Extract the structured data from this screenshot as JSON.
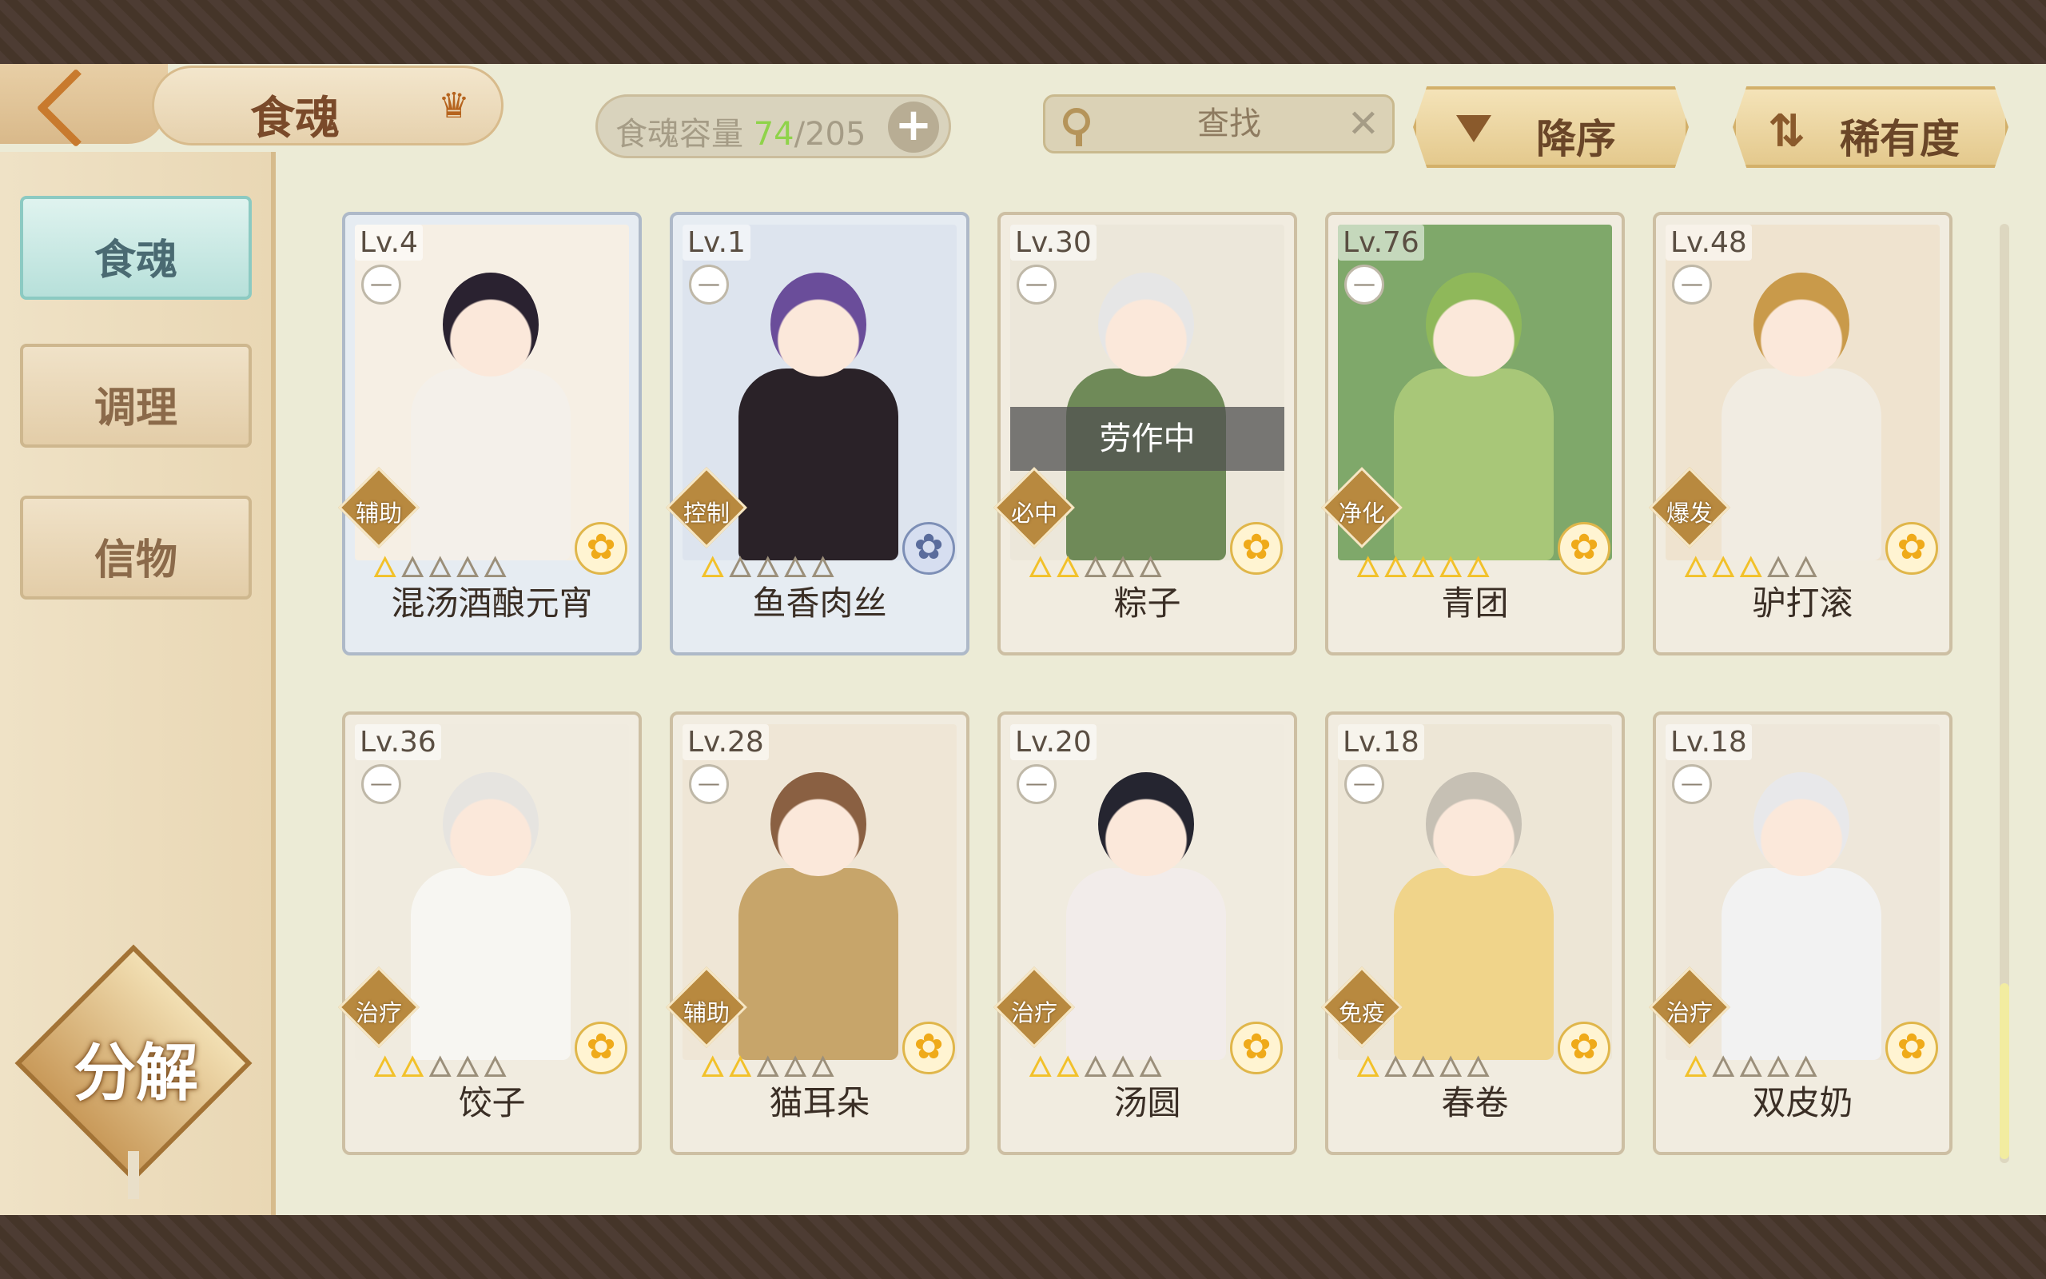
{
  "header": {
    "title": "食魂",
    "capacity_label": "食魂容量",
    "capacity_current": "74",
    "capacity_max": "/205",
    "search_placeholder": "查找",
    "sort_label": "降序",
    "rarity_label": "稀有度"
  },
  "sidebar": {
    "items": [
      {
        "label": "食魂"
      },
      {
        "label": "调理"
      },
      {
        "label": "信物"
      }
    ],
    "decompose_label": "分解"
  },
  "cards": [
    {
      "level": "Lv.4",
      "name": "混汤酒酿元宵",
      "role": "辅助",
      "stars": 1
    },
    {
      "level": "Lv.1",
      "name": "鱼香肉丝",
      "role": "控制",
      "stars": 1
    },
    {
      "level": "Lv.30",
      "name": "粽子",
      "role": "必中",
      "stars": 2,
      "status": "劳作中"
    },
    {
      "level": "Lv.76",
      "name": "青团",
      "role": "净化",
      "stars": 5
    },
    {
      "level": "Lv.48",
      "name": "驴打滚",
      "role": "爆发",
      "stars": 3
    },
    {
      "level": "Lv.36",
      "name": "饺子",
      "role": "治疗",
      "stars": 2
    },
    {
      "level": "Lv.28",
      "name": "猫耳朵",
      "role": "辅助",
      "stars": 2
    },
    {
      "level": "Lv.20",
      "name": "汤圆",
      "role": "治疗",
      "stars": 2
    },
    {
      "level": "Lv.18",
      "name": "春卷",
      "role": "免疫",
      "stars": 1
    },
    {
      "level": "Lv.18",
      "name": "双皮奶",
      "role": "治疗",
      "stars": 1
    }
  ],
  "colors": {
    "accent_gold": "#d3b06a",
    "active_tab": "#b7e0da",
    "capacity_green": "#8fd34a"
  },
  "icons": {
    "back": "chevron-left-icon",
    "crown": "crown-icon",
    "search": "search-icon",
    "clear": "close-icon",
    "sort": "triangle-down-icon",
    "rarity": "swap-icon",
    "rarity_flower": "flower-icon"
  }
}
